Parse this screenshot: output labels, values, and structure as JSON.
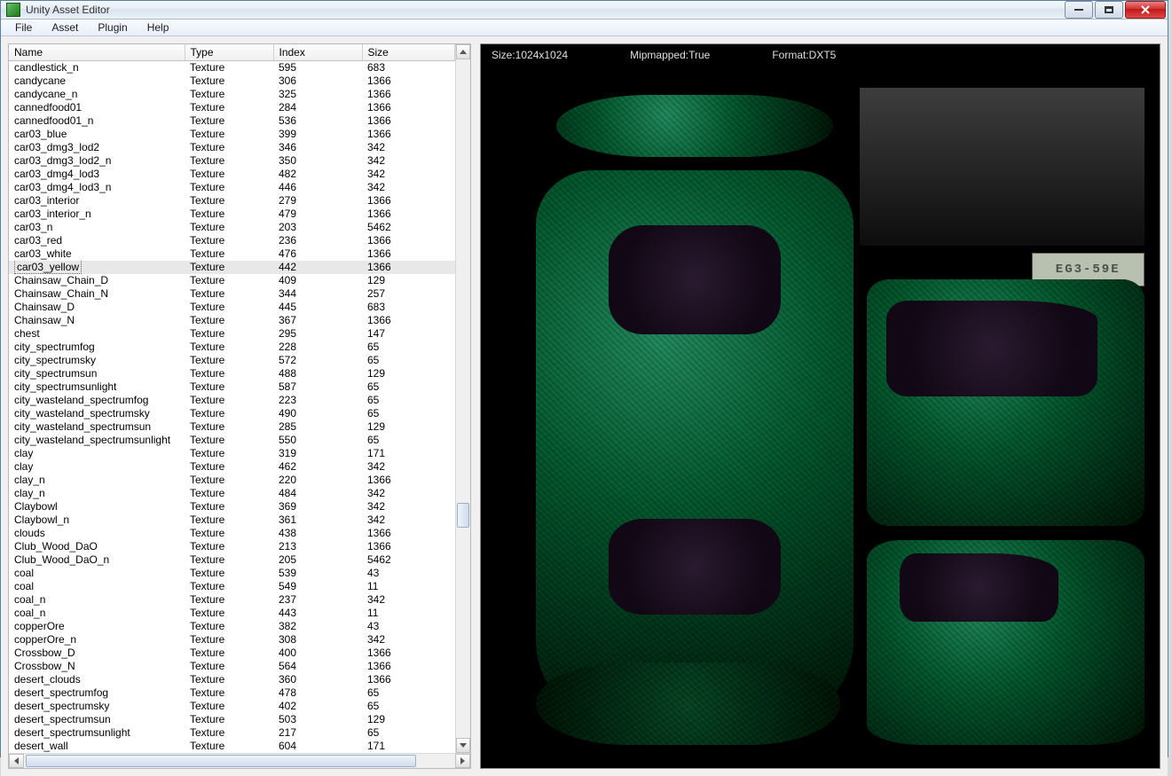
{
  "window": {
    "title": "Unity Asset Editor"
  },
  "menu": {
    "file": "File",
    "asset": "Asset",
    "plugin": "Plugin",
    "help": "Help"
  },
  "columns": {
    "name": "Name",
    "type": "Type",
    "index": "Index",
    "size": "Size"
  },
  "info": {
    "size": "Size:1024x1024",
    "mipmapped": "Mipmapped:True",
    "format": "Format:DXT5"
  },
  "plate": "EG3-59E",
  "selected_index": 15,
  "rows": [
    {
      "name": "candlestick_n",
      "type": "Texture",
      "index": "595",
      "size": "683"
    },
    {
      "name": "candycane",
      "type": "Texture",
      "index": "306",
      "size": "1366"
    },
    {
      "name": "candycane_n",
      "type": "Texture",
      "index": "325",
      "size": "1366"
    },
    {
      "name": "cannedfood01",
      "type": "Texture",
      "index": "284",
      "size": "1366"
    },
    {
      "name": "cannedfood01_n",
      "type": "Texture",
      "index": "536",
      "size": "1366"
    },
    {
      "name": "car03_blue",
      "type": "Texture",
      "index": "399",
      "size": "1366"
    },
    {
      "name": "car03_dmg3_lod2",
      "type": "Texture",
      "index": "346",
      "size": "342"
    },
    {
      "name": "car03_dmg3_lod2_n",
      "type": "Texture",
      "index": "350",
      "size": "342"
    },
    {
      "name": "car03_dmg4_lod3",
      "type": "Texture",
      "index": "482",
      "size": "342"
    },
    {
      "name": "car03_dmg4_lod3_n",
      "type": "Texture",
      "index": "446",
      "size": "342"
    },
    {
      "name": "car03_interior",
      "type": "Texture",
      "index": "279",
      "size": "1366"
    },
    {
      "name": "car03_interior_n",
      "type": "Texture",
      "index": "479",
      "size": "1366"
    },
    {
      "name": "car03_n",
      "type": "Texture",
      "index": "203",
      "size": "5462"
    },
    {
      "name": "car03_red",
      "type": "Texture",
      "index": "236",
      "size": "1366"
    },
    {
      "name": "car03_white",
      "type": "Texture",
      "index": "476",
      "size": "1366"
    },
    {
      "name": "car03_yellow",
      "type": "Texture",
      "index": "442",
      "size": "1366"
    },
    {
      "name": "Chainsaw_Chain_D",
      "type": "Texture",
      "index": "409",
      "size": "129"
    },
    {
      "name": "Chainsaw_Chain_N",
      "type": "Texture",
      "index": "344",
      "size": "257"
    },
    {
      "name": "Chainsaw_D",
      "type": "Texture",
      "index": "445",
      "size": "683"
    },
    {
      "name": "Chainsaw_N",
      "type": "Texture",
      "index": "367",
      "size": "1366"
    },
    {
      "name": "chest",
      "type": "Texture",
      "index": "295",
      "size": "147"
    },
    {
      "name": "city_spectrumfog",
      "type": "Texture",
      "index": "228",
      "size": "65"
    },
    {
      "name": "city_spectrumsky",
      "type": "Texture",
      "index": "572",
      "size": "65"
    },
    {
      "name": "city_spectrumsun",
      "type": "Texture",
      "index": "488",
      "size": "129"
    },
    {
      "name": "city_spectrumsunlight",
      "type": "Texture",
      "index": "587",
      "size": "65"
    },
    {
      "name": "city_wasteland_spectrumfog",
      "type": "Texture",
      "index": "223",
      "size": "65"
    },
    {
      "name": "city_wasteland_spectrumsky",
      "type": "Texture",
      "index": "490",
      "size": "65"
    },
    {
      "name": "city_wasteland_spectrumsun",
      "type": "Texture",
      "index": "285",
      "size": "129"
    },
    {
      "name": "city_wasteland_spectrumsunlight",
      "type": "Texture",
      "index": "550",
      "size": "65"
    },
    {
      "name": "clay",
      "type": "Texture",
      "index": "319",
      "size": "171"
    },
    {
      "name": "clay",
      "type": "Texture",
      "index": "462",
      "size": "342"
    },
    {
      "name": "clay_n",
      "type": "Texture",
      "index": "220",
      "size": "1366"
    },
    {
      "name": "clay_n",
      "type": "Texture",
      "index": "484",
      "size": "342"
    },
    {
      "name": "Claybowl",
      "type": "Texture",
      "index": "369",
      "size": "342"
    },
    {
      "name": "Claybowl_n",
      "type": "Texture",
      "index": "361",
      "size": "342"
    },
    {
      "name": "clouds",
      "type": "Texture",
      "index": "438",
      "size": "1366"
    },
    {
      "name": "Club_Wood_DaO",
      "type": "Texture",
      "index": "213",
      "size": "1366"
    },
    {
      "name": "Club_Wood_DaO_n",
      "type": "Texture",
      "index": "205",
      "size": "5462"
    },
    {
      "name": "coal",
      "type": "Texture",
      "index": "539",
      "size": "43"
    },
    {
      "name": "coal",
      "type": "Texture",
      "index": "549",
      "size": "11"
    },
    {
      "name": "coal_n",
      "type": "Texture",
      "index": "237",
      "size": "342"
    },
    {
      "name": "coal_n",
      "type": "Texture",
      "index": "443",
      "size": "11"
    },
    {
      "name": "copperOre",
      "type": "Texture",
      "index": "382",
      "size": "43"
    },
    {
      "name": "copperOre_n",
      "type": "Texture",
      "index": "308",
      "size": "342"
    },
    {
      "name": "Crossbow_D",
      "type": "Texture",
      "index": "400",
      "size": "1366"
    },
    {
      "name": "Crossbow_N",
      "type": "Texture",
      "index": "564",
      "size": "1366"
    },
    {
      "name": "desert_clouds",
      "type": "Texture",
      "index": "360",
      "size": "1366"
    },
    {
      "name": "desert_spectrumfog",
      "type": "Texture",
      "index": "478",
      "size": "65"
    },
    {
      "name": "desert_spectrumsky",
      "type": "Texture",
      "index": "402",
      "size": "65"
    },
    {
      "name": "desert_spectrumsun",
      "type": "Texture",
      "index": "503",
      "size": "129"
    },
    {
      "name": "desert_spectrumsunlight",
      "type": "Texture",
      "index": "217",
      "size": "65"
    },
    {
      "name": "desert_wall",
      "type": "Texture",
      "index": "604",
      "size": "171"
    }
  ]
}
